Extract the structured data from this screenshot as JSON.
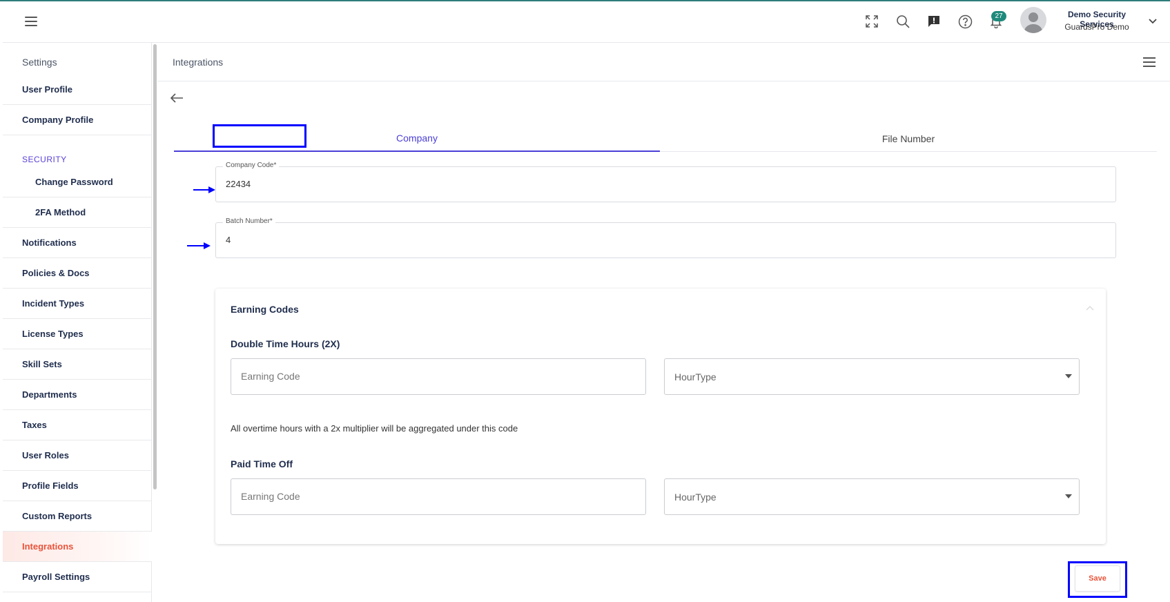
{
  "header": {
    "user_name": "Demo Security Services",
    "user_subtitle": "GuardsPro Demo",
    "notification_count": "27",
    "icons": [
      "menu-icon",
      "fullscreen-icon",
      "search-icon",
      "feedback-icon",
      "help-icon",
      "bell-icon",
      "avatar",
      "chevron-down-icon"
    ]
  },
  "sidebar": {
    "title": "Settings",
    "items": [
      {
        "label": "User Profile"
      },
      {
        "label": "Company Profile"
      },
      {
        "label": "SECURITY"
      },
      {
        "label": "Change Password"
      },
      {
        "label": "2FA Method"
      },
      {
        "label": "Notifications"
      },
      {
        "label": "Policies & Docs"
      },
      {
        "label": "Incident Types"
      },
      {
        "label": "License Types"
      },
      {
        "label": "Skill Sets"
      },
      {
        "label": "Departments"
      },
      {
        "label": "Taxes"
      },
      {
        "label": "User Roles"
      },
      {
        "label": "Profile Fields"
      },
      {
        "label": "Custom Reports"
      },
      {
        "label": "Integrations"
      },
      {
        "label": "Payroll Settings"
      }
    ],
    "active_item": "Integrations"
  },
  "page": {
    "title": "Integrations",
    "tabs": [
      {
        "label": "Company"
      },
      {
        "label": "File Number"
      }
    ],
    "active_tab": "Company"
  },
  "form": {
    "company_code_label": "Company Code*",
    "company_code_value": "22434",
    "batch_number_label": "Batch Number*",
    "batch_number_value": "4"
  },
  "earning_codes": {
    "title": "Earning Codes",
    "double_time": {
      "title": "Double Time Hours (2X)",
      "earning_code_placeholder": "Earning Code",
      "hour_type_placeholder": "HourType",
      "helper": "All overtime hours with a 2x multiplier will be aggregated under this code"
    },
    "paid_time_off": {
      "title": "Paid Time Off",
      "earning_code_placeholder": "Earning Code",
      "hour_type_placeholder": "HourType"
    }
  },
  "actions": {
    "save_label": "Save"
  },
  "colors": {
    "accent": "#4a3ed8",
    "active_nav": "#e8533a",
    "badge": "#1e8a7c",
    "highlight": "#0000ff"
  }
}
